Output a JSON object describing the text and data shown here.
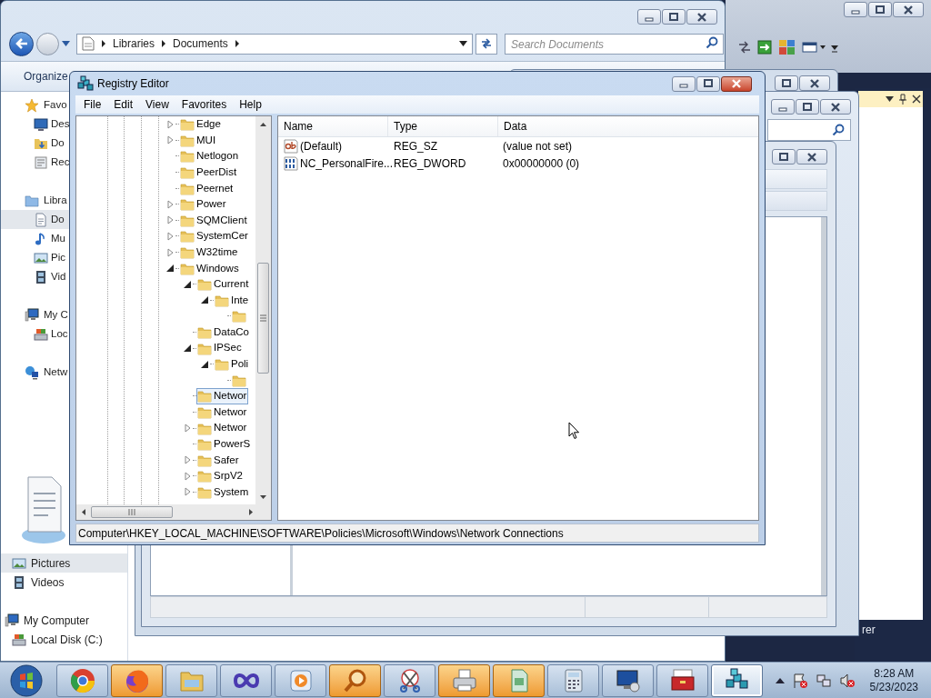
{
  "explorer": {
    "address": [
      "Libraries",
      "Documents"
    ],
    "search_placeholder": "Search Documents",
    "toolbar": [
      "Organize"
    ],
    "nav": [
      {
        "label": "Favo",
        "kind": "star",
        "selected": false,
        "children": [
          {
            "label": "Des",
            "kind": "desktop",
            "selected": false
          },
          {
            "label": "Do",
            "kind": "downloads",
            "selected": false
          },
          {
            "label": "Rec",
            "kind": "recent",
            "selected": false
          }
        ]
      },
      {
        "label": "Libra",
        "kind": "library",
        "selected": false,
        "children": [
          {
            "label": "Do",
            "kind": "document",
            "selected": true
          },
          {
            "label": "Mu",
            "kind": "music",
            "selected": false
          },
          {
            "label": "Pic",
            "kind": "pictures",
            "selected": false
          },
          {
            "label": "Vid",
            "kind": "videos",
            "selected": false
          }
        ]
      },
      {
        "label": "My C",
        "kind": "computer",
        "selected": false,
        "children": [
          {
            "label": "Loc",
            "kind": "disk",
            "selected": false
          }
        ]
      },
      {
        "label": "Netw",
        "kind": "network",
        "selected": false
      }
    ],
    "lower_nav": [
      {
        "label": "Pictures",
        "kind": "pictures",
        "selected": true
      },
      {
        "label": "Videos",
        "kind": "videos",
        "selected": false
      },
      {
        "label": "My Computer",
        "kind": "computer",
        "selected": false,
        "children": [
          {
            "label": "Local Disk (C:)",
            "kind": "disk",
            "selected": false
          }
        ]
      }
    ]
  },
  "registry": {
    "title": "Registry Editor",
    "menu": [
      "File",
      "Edit",
      "View",
      "Favorites",
      "Help"
    ],
    "tree": [
      {
        "name": "Edge",
        "kind": "branch",
        "expanded": false,
        "selected": false
      },
      {
        "name": "MUI",
        "kind": "branch",
        "expanded": false,
        "selected": false
      },
      {
        "name": "Netlogon",
        "kind": "leaf",
        "selected": false
      },
      {
        "name": "PeerDist",
        "kind": "leaf",
        "selected": false
      },
      {
        "name": "Peernet",
        "kind": "leaf",
        "selected": false
      },
      {
        "name": "Power",
        "kind": "branch",
        "expanded": false,
        "selected": false
      },
      {
        "name": "SQMClient",
        "kind": "branch",
        "expanded": false,
        "selected": false
      },
      {
        "name": "SystemCer",
        "kind": "branch",
        "expanded": false,
        "selected": false
      },
      {
        "name": "W32time",
        "kind": "branch",
        "expanded": false,
        "selected": false
      },
      {
        "name": "Windows",
        "kind": "branch",
        "expanded": true,
        "selected": false,
        "children": [
          {
            "name": "Current",
            "kind": "branch",
            "expanded": true,
            "selected": false,
            "children": [
              {
                "name": "Inte",
                "kind": "branch",
                "expanded": true,
                "selected": false,
                "children": [
                  {
                    "kind": "leaf",
                    "selected": false
                  }
                ]
              }
            ]
          },
          {
            "name": "DataCo",
            "kind": "leaf",
            "selected": false
          },
          {
            "name": "IPSec",
            "kind": "branch",
            "expanded": true,
            "selected": false,
            "children": [
              {
                "name": "Poli",
                "kind": "branch",
                "expanded": true,
                "selected": false,
                "children": [
                  {
                    "kind": "leaf",
                    "selected": false
                  }
                ]
              }
            ]
          },
          {
            "name": "Networ",
            "kind": "leaf",
            "selected": true
          },
          {
            "name": "Networ",
            "kind": "leaf",
            "selected": false
          },
          {
            "name": "Networ",
            "kind": "branch",
            "expanded": false,
            "selected": false
          },
          {
            "name": "PowerS",
            "kind": "leaf",
            "selected": false
          },
          {
            "name": "Safer",
            "kind": "branch",
            "expanded": false,
            "selected": false
          },
          {
            "name": "SrpV2",
            "kind": "branch",
            "expanded": false,
            "selected": false
          },
          {
            "name": "System",
            "kind": "branch",
            "expanded": false,
            "selected": false
          }
        ]
      }
    ],
    "columns": [
      "Name",
      "Type",
      "Data"
    ],
    "values": [
      {
        "kind": "string",
        "name": "(Default)",
        "type": "REG_SZ",
        "data": "(value not set)"
      },
      {
        "kind": "binary",
        "name": "NC_PersonalFire...",
        "type": "REG_DWORD",
        "data": "0x00000000 (0)"
      }
    ],
    "status": "Computer\\HKEY_LOCAL_MACHINE\\SOFTWARE\\Policies\\Microsoft\\Windows\\Network Connections"
  },
  "side_panel": {
    "caption": "rer"
  },
  "taskbar": {
    "apps": [
      {
        "kind": "wheel",
        "flashing": false,
        "selected": false
      },
      {
        "kind": "fox",
        "flashing": true,
        "selected": false
      },
      {
        "kind": "folder",
        "flashing": false,
        "selected": false
      },
      {
        "kind": "infinity",
        "flashing": false,
        "selected": false
      },
      {
        "kind": "play",
        "flashing": false,
        "selected": false
      },
      {
        "kind": "magnifier",
        "flashing": true,
        "selected": false
      },
      {
        "kind": "scissors",
        "flashing": false,
        "selected": false
      },
      {
        "kind": "printer",
        "flashing": true,
        "selected": false
      },
      {
        "kind": "document",
        "flashing": true,
        "selected": false
      },
      {
        "kind": "calculator",
        "flashing": false,
        "selected": false
      },
      {
        "kind": "monitor",
        "flashing": false,
        "selected": false
      },
      {
        "kind": "toolbox",
        "flashing": false,
        "selected": false
      },
      {
        "kind": "cubes",
        "flashing": false,
        "selected": true
      }
    ],
    "clock": {
      "time": "8:28 AM",
      "date": "5/23/2023"
    }
  }
}
